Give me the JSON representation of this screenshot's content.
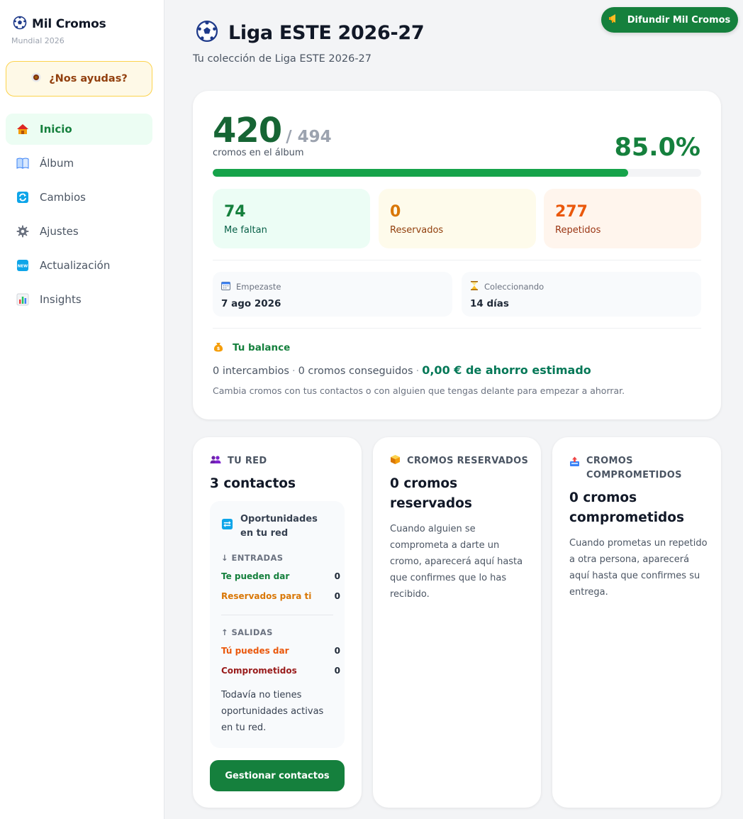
{
  "sidebar": {
    "brand_title": "Mil Cromos",
    "brand_sub": "Mundial 2026",
    "help_label": "¿Nos ayudas?",
    "items": [
      {
        "label": "Inicio",
        "icon": "house-icon"
      },
      {
        "label": "Álbum",
        "icon": "book-icon"
      },
      {
        "label": "Cambios",
        "icon": "swap-icon"
      },
      {
        "label": "Ajustes",
        "icon": "gear-icon"
      },
      {
        "label": "Actualización",
        "icon": "new-badge-icon"
      },
      {
        "label": "Insights",
        "icon": "bar-chart-icon"
      }
    ]
  },
  "header": {
    "title": "Liga ESTE 2026-27",
    "subtitle": "Tu colección de Liga ESTE 2026-27",
    "share_label": "Difundir Mil Cromos"
  },
  "summary": {
    "count": "420",
    "total": "/ 494",
    "count_label": "cromos en el álbum",
    "percent": "85.0%",
    "progress_fraction": 0.85,
    "stats": {
      "faltan": {
        "value": "74",
        "label": "Me faltan"
      },
      "reservados": {
        "value": "0",
        "label": "Reservados"
      },
      "repetidos": {
        "value": "277",
        "label": "Repetidos"
      }
    },
    "started": {
      "label": "Empezaste",
      "value": "7 ago 2026"
    },
    "collecting": {
      "label": "Coleccionando",
      "value": "14 días"
    },
    "balance": {
      "title": "Tu balance",
      "exchanges": "0 intercambios",
      "obtained": "0 cromos conseguidos",
      "savings": "0,00 € de ahorro estimado",
      "hint": "Cambia cromos con tus contactos o con alguien que tengas delante para empezar a ahorrar."
    }
  },
  "network": {
    "head": "TU RED",
    "title": "3 contactos",
    "opp_title": "Oportunidades en tu red",
    "in_label": "↓ ENTRADAS",
    "in_rows": [
      {
        "label": "Te pueden dar",
        "value": "0",
        "color": "#15803d"
      },
      {
        "label": "Reservados para ti",
        "value": "0",
        "color": "#d97706"
      }
    ],
    "out_label": "↑ SALIDAS",
    "out_rows": [
      {
        "label": "Tú puedes dar",
        "value": "0",
        "color": "#ea580c"
      },
      {
        "label": "Comprometidos",
        "value": "0",
        "color": "#991b1b"
      }
    ],
    "empty": "Todavía no tienes oportunidades activas en tu red.",
    "manage_label": "Gestionar contactos"
  },
  "reserved": {
    "head": "CROMOS RESERVADOS",
    "title": "0 cromos reservados",
    "desc": "Cuando alguien se comprometa a darte un cromo, aparecerá aquí hasta que confirmes que lo has recibido."
  },
  "committed": {
    "head": "CROMOS COMPROMETIDOS",
    "title": "0 cromos comprometidos",
    "desc": "Cuando prometas un repetido a otra persona, aparecerá aquí hasta que confirmes su entrega."
  },
  "colors": {
    "accent": "#15803d",
    "progress": "#16a34a"
  }
}
